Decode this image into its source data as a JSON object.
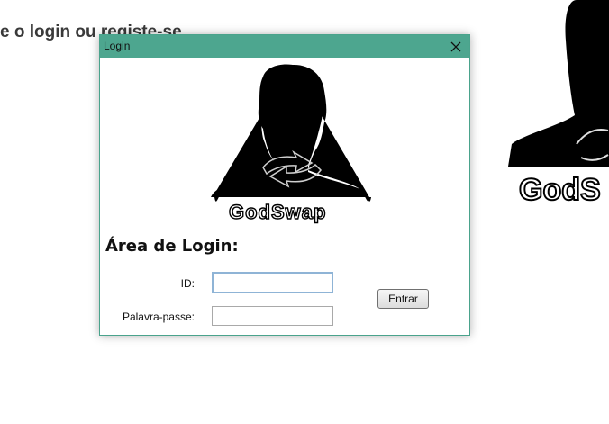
{
  "background": {
    "heading": "e o login ou registe-se",
    "logo_text": "GodS"
  },
  "dialog": {
    "title": "Login",
    "close_icon": "close-icon",
    "logo_text": "GodSwap",
    "heading": "Área de Login:",
    "id_label": "ID:",
    "id_value": "",
    "password_label": "Palavra-passe:",
    "password_value": "",
    "enter_button": "Entrar"
  },
  "colors": {
    "titlebar": "#4da68f",
    "border": "#4aa38c",
    "focus": "#8fb4d6"
  }
}
